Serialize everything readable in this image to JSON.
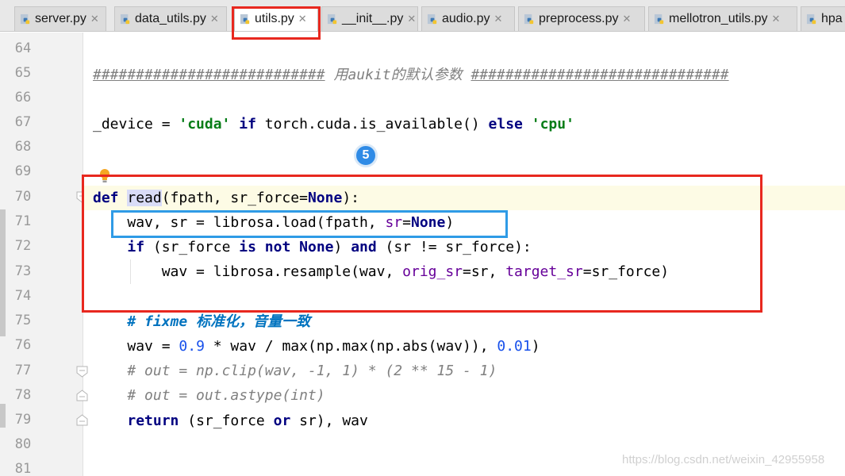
{
  "tabs": [
    {
      "label": "server.py",
      "active": false
    },
    {
      "label": "data_utils.py",
      "active": false
    },
    {
      "label": "utils.py",
      "active": true
    },
    {
      "label": "__init__.py",
      "active": false
    },
    {
      "label": "audio.py",
      "active": false
    },
    {
      "label": "preprocess.py",
      "active": false
    },
    {
      "label": "mellotron_utils.py",
      "active": false
    },
    {
      "label": "hpa",
      "active": false
    }
  ],
  "line_numbers": [
    "64",
    "65",
    "66",
    "67",
    "68",
    "69",
    "70",
    "71",
    "72",
    "73",
    "74",
    "75",
    "76",
    "77",
    "78",
    "79",
    "80",
    "81"
  ],
  "code": {
    "l65": {
      "hash_a": "###########################",
      "text": " 用aukit的默认参数 ",
      "hash_b": "##############################"
    },
    "l67": {
      "var": "_device = ",
      "s1": "'cuda'",
      "if": "if",
      "mid": " torch.cuda.is_available() ",
      "else": "else",
      "s2": "'cpu'"
    },
    "l70": {
      "def": "def",
      "name": "read",
      "open": "(fpath, sr_force=",
      "none": "None",
      "close": "):"
    },
    "l71": {
      "a": "wav, sr = librosa.load(fpath, ",
      "kw": "sr",
      "eq": "=",
      "none": "None",
      "close": ")"
    },
    "l72": {
      "if": "if",
      "a": " (sr_force ",
      "isnot": "is not",
      "sp": " ",
      "none": "None",
      "b": ") ",
      "and": "and",
      "c": " (sr != sr_force):"
    },
    "l73": {
      "a": "wav = librosa.resample(wav, ",
      "kw1": "orig_sr",
      "b": "=sr, ",
      "kw2": "target_sr",
      "c": "=sr_force)"
    },
    "l75": {
      "hash": "# ",
      "todo": "fixme 标准化，音量一致"
    },
    "l76": {
      "a": "wav = ",
      "n1": "0.9",
      "b": " * wav / max(np.max(np.abs(wav)), ",
      "n2": "0.01",
      "c": ")"
    },
    "l77": "# out = np.clip(wav, -1, 1) * (2 ** 15 - 1)",
    "l78": "# out = out.astype(int)",
    "l79": {
      "ret": "return",
      "a": " (sr_force ",
      "or": "or",
      "b": " sr), wav"
    }
  },
  "badge": "5",
  "watermark": "https://blog.csdn.net/weixin_42955958",
  "colors": {
    "highlight_red": "#e8281f",
    "highlight_blue": "#2f9be6",
    "keyword": "#000080",
    "string": "#067d17",
    "number": "#1750eb",
    "comment": "#808080"
  },
  "icons": {
    "tab_file": "python-file-icon",
    "gutter": "fold-marker-icon",
    "hint": "lightbulb-icon"
  }
}
